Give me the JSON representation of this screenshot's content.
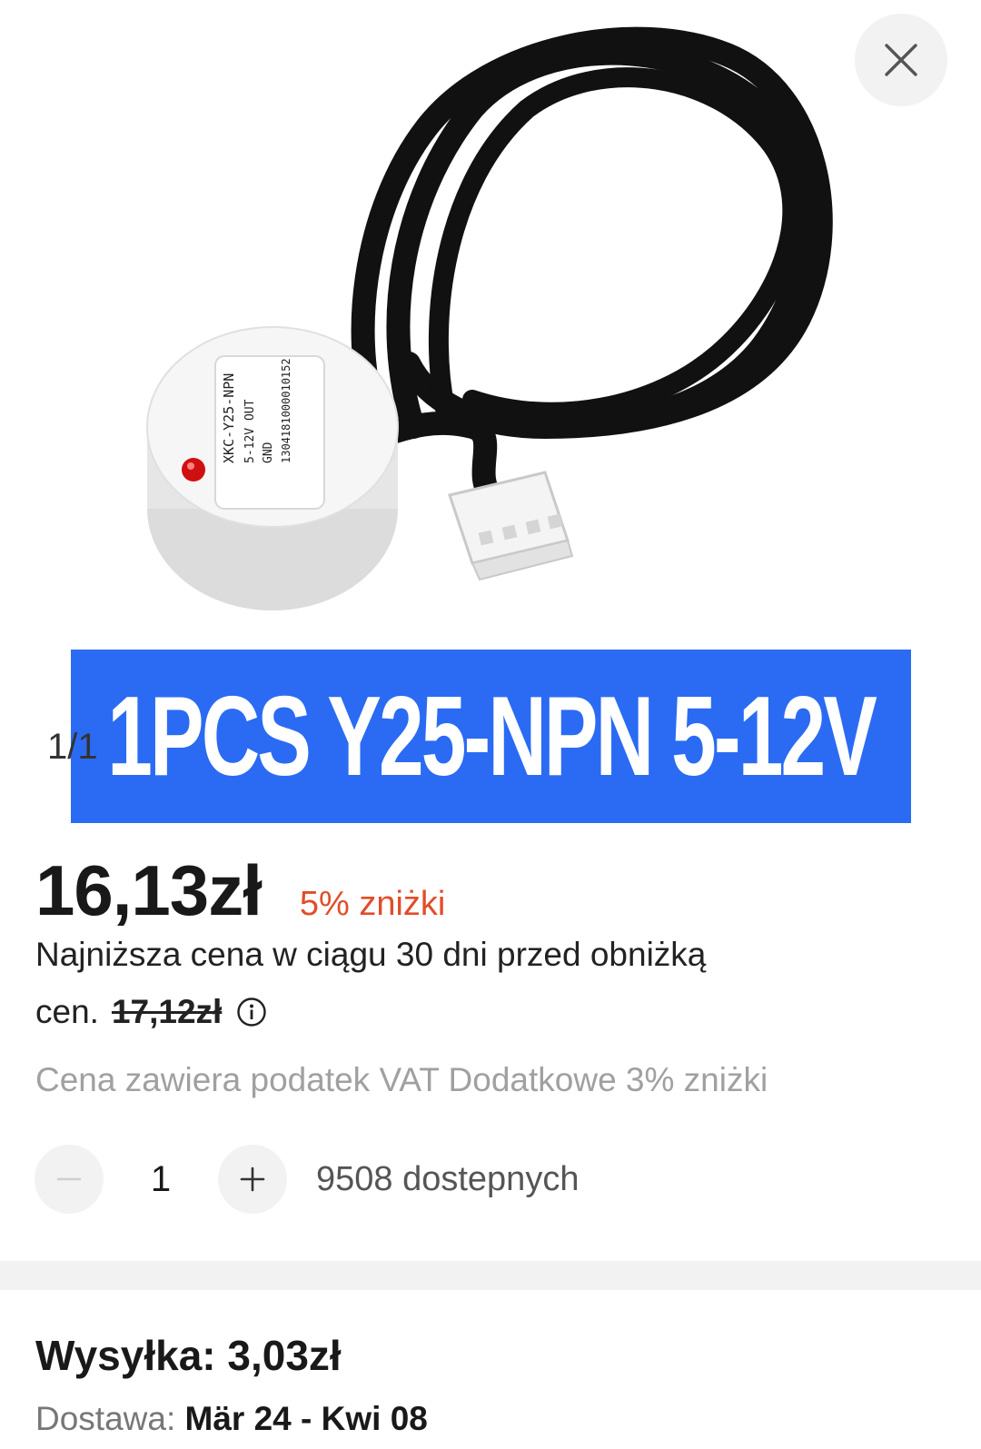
{
  "gallery": {
    "close_icon": "close-icon",
    "image_banner_text": "1PCS Y25-NPN 5-12V",
    "counter": "1/1",
    "product_label_lines": [
      "XKC-Y25-NPN",
      "5-12V OUT",
      "GND",
      "1304181000010152"
    ],
    "banner_color": "#2b6bf3"
  },
  "price": {
    "current": "16,13zł",
    "discount": "5% zniżki",
    "lowest_line_1": "Najniższa cena w ciągu 30 dni przed obniżką",
    "lowest_prefix": "cen.",
    "old_price": "17,12zł",
    "info_icon": "info-icon",
    "vat_note": "Cena zawiera podatek VAT Dodatkowe 3% zniżki",
    "discount_color": "#e14d2a"
  },
  "quantity": {
    "decrease_icon": "minus-icon",
    "value": "1",
    "increase_icon": "plus-icon",
    "stock": "9508 dostepnych"
  },
  "shipping": {
    "title": "Wysyłka: 3,03zł",
    "delivery_label": "Dostawa: ",
    "delivery_value": "Mär 24 - Kwi 08"
  }
}
